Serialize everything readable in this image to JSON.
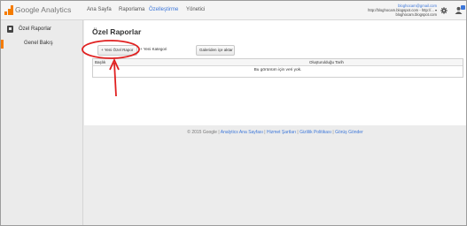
{
  "header": {
    "logo_text": "Google Analytics",
    "nav": [
      "Ana Sayfa",
      "Raporlama",
      "Özelleştirme",
      "Yönetici"
    ],
    "active_nav": "Özelleştirme",
    "account_email": "bloghocam@gmail.com",
    "account_line2": "http://bloghocam.blogspot.com - http://...",
    "account_line3": "bloghocam.blogspot.com"
  },
  "sidebar": {
    "section": "Özel Raporlar",
    "item": "Genel Bakış"
  },
  "main": {
    "title": "Özel Raporlar",
    "buttons": {
      "new_report": "+ Yeni Özel Rapor",
      "new_category": "+ Yeni Kategori",
      "import": "Galeriden içe aktar"
    },
    "table": {
      "col_title": "Başlık",
      "col_date": "Oluşturulduğu Tarih",
      "empty": "Bu görünüm için veri yok."
    }
  },
  "footer": {
    "copyright": "© 2015 Google",
    "links": [
      "Analytics Ana Sayfası",
      "Hizmet Şartları",
      "Gizlilik Politikası",
      "Görüş Gönder"
    ]
  },
  "colors": {
    "accent": "#3d77d9",
    "brand": "#f57c00",
    "annotation": "#e02020"
  }
}
